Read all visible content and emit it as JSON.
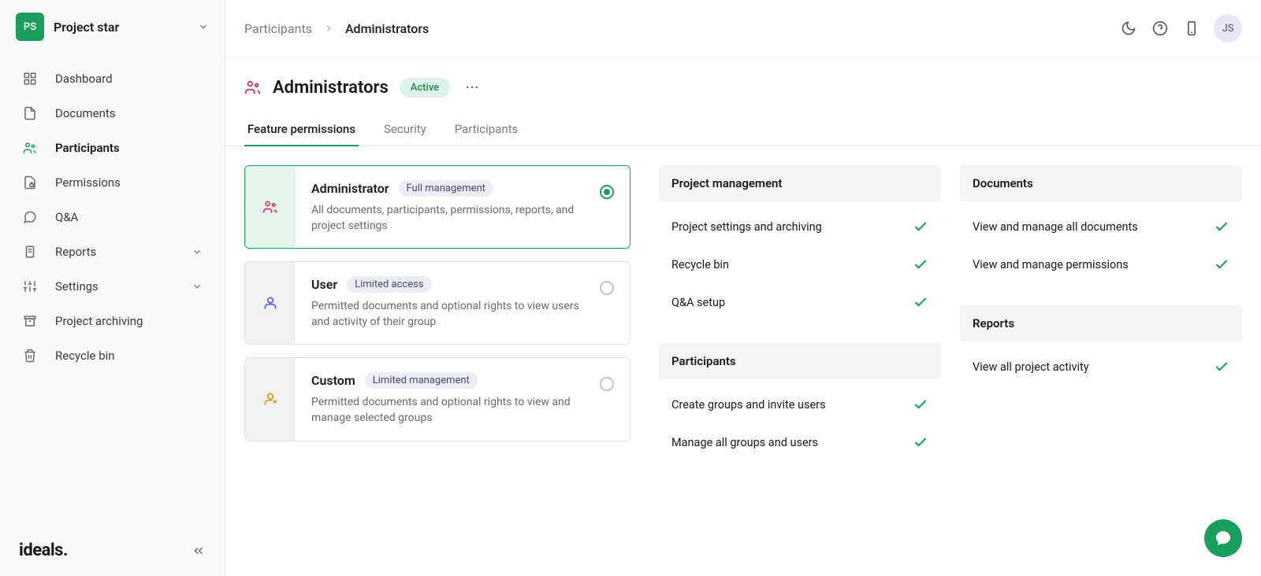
{
  "project": {
    "badge": "PS",
    "name": "Project star"
  },
  "nav": {
    "dashboard": "Dashboard",
    "documents": "Documents",
    "participants": "Participants",
    "permissions": "Permissions",
    "qa": "Q&A",
    "reports": "Reports",
    "settings": "Settings",
    "archiving": "Project archiving",
    "recycle": "Recycle bin"
  },
  "brand": "ideals.",
  "breadcrumb": {
    "parent": "Participants",
    "current": "Administrators"
  },
  "user": {
    "initials": "JS"
  },
  "page": {
    "title": "Administrators",
    "status": "Active"
  },
  "tabs": {
    "feature": "Feature permissions",
    "security": "Security",
    "participants": "Participants"
  },
  "roles": [
    {
      "title": "Administrator",
      "badge": "Full management",
      "desc": "All documents, participants, permissions, reports, and project settings",
      "iconColor": "#d6336c",
      "selected": true
    },
    {
      "title": "User",
      "badge": "Limited access",
      "desc": "Permitted documents and optional rights to view users and activity of their group",
      "iconColor": "#4263eb",
      "selected": false
    },
    {
      "title": "Custom",
      "badge": "Limited management",
      "desc": "Permitted documents and optional rights to view and manage selected groups",
      "iconColor": "#d4a015",
      "selected": false
    }
  ],
  "permissions": {
    "col1": [
      {
        "header": "Project management",
        "items": [
          "Project settings and archiving",
          "Recycle bin",
          "Q&A setup"
        ]
      },
      {
        "header": "Participants",
        "items": [
          "Create groups and invite users",
          "Manage all groups and users"
        ]
      }
    ],
    "col2": [
      {
        "header": "Documents",
        "items": [
          "View and manage all documents",
          "View and manage permissions"
        ]
      },
      {
        "header": "Reports",
        "items": [
          "View all project activity"
        ]
      }
    ]
  }
}
